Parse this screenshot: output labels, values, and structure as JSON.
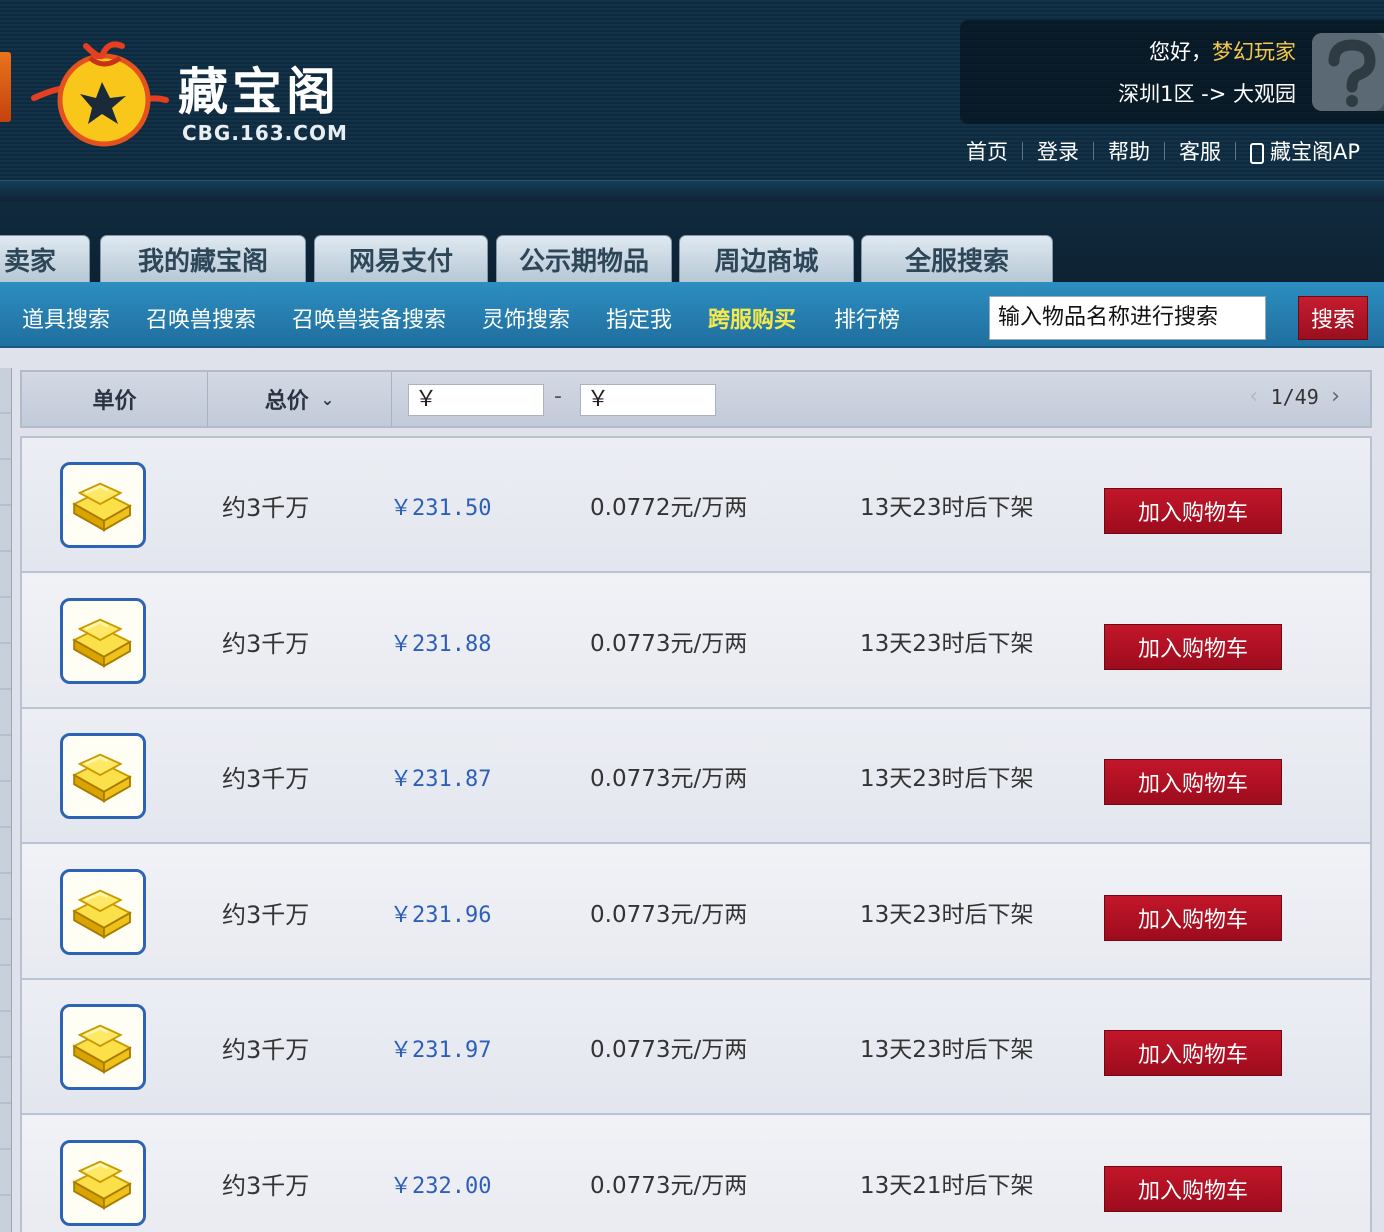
{
  "header": {
    "logo_title": "藏宝阁",
    "logo_domain": "CBG.163.COM",
    "greeting_prefix": "您好，",
    "username": "梦幻玩家",
    "server": "深圳1区 -> 大观园",
    "top_nav": [
      "首页",
      "登录",
      "帮助",
      "客服"
    ],
    "app_link": "藏宝阁AP"
  },
  "tabs": [
    "卖家",
    "我的藏宝阁",
    "网易支付",
    "公示期物品",
    "周边商城",
    "全服搜索"
  ],
  "subnav": {
    "items": [
      "道具搜索",
      "召唤兽搜索",
      "召唤兽装备搜索",
      "灵饰搜索",
      "指定我",
      "跨服购买",
      "排行榜"
    ],
    "search_placeholder": "输入物品名称进行搜索",
    "search_button": "搜索"
  },
  "sortbar": {
    "unit_price": "单价",
    "total_price": "总价",
    "currency_symbol": "￥",
    "range_dash": "-",
    "page_current": "1",
    "page_total": "49",
    "page_text": "1/49"
  },
  "rows": [
    {
      "amount": "约3千万",
      "price": "￥231.50",
      "unit_price": "0.0772元/万两",
      "expire": "13天23时后下架",
      "button": "加入购物车"
    },
    {
      "amount": "约3千万",
      "price": "￥231.88",
      "unit_price": "0.0773元/万两",
      "expire": "13天23时后下架",
      "button": "加入购物车"
    },
    {
      "amount": "约3千万",
      "price": "￥231.87",
      "unit_price": "0.0773元/万两",
      "expire": "13天23时后下架",
      "button": "加入购物车"
    },
    {
      "amount": "约3千万",
      "price": "￥231.96",
      "unit_price": "0.0773元/万两",
      "expire": "13天23时后下架",
      "button": "加入购物车"
    },
    {
      "amount": "约3千万",
      "price": "￥231.97",
      "unit_price": "0.0773元/万两",
      "expire": "13天23时后下架",
      "button": "加入购物车"
    },
    {
      "amount": "约3千万",
      "price": "￥232.00",
      "unit_price": "0.0773元/万两",
      "expire": "13天21时后下架",
      "button": "加入购物车"
    }
  ],
  "colors": {
    "header_bg": "#0f2a3e",
    "subnav_bg": "#2d8ec0",
    "accent_red": "#b31223",
    "price_blue": "#2e5fb8",
    "highlight_yellow": "#f5e94c",
    "username_gold": "#f5c94a"
  },
  "icons": {
    "logo": "money-bag-logo-icon",
    "avatar": "unknown-user-question-icon",
    "app": "mobile-phone-icon",
    "item": "gold-ingot-icon"
  }
}
